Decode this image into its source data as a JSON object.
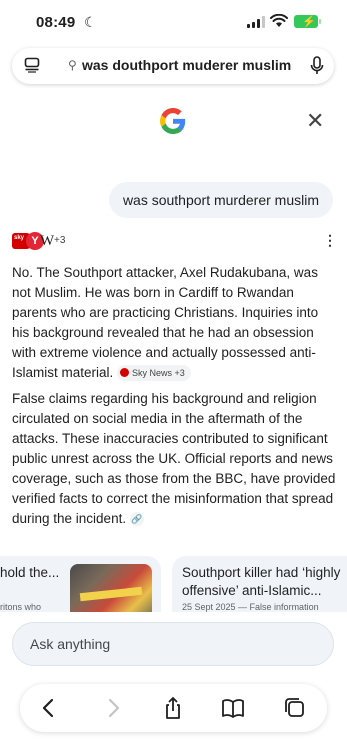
{
  "status": {
    "time": "08:49"
  },
  "address_bar": {
    "query": "was douthport muderer muslim"
  },
  "chat": {
    "user_message": "was southport murderer muslim",
    "sources": {
      "sky_label": "sky",
      "y_label": "Y",
      "w_label": "W",
      "more_count": "+3"
    },
    "paragraph1": "No. The Southport attacker, Axel Rudakubana, was not Muslim. He was born in Cardiff to Rwandan parents who are practicing Christians. Inquiries into his background revealed that he had an obsession with extreme violence and actually possessed anti-Islamist material.",
    "paragraph1_chip": "Sky News +3",
    "paragraph2": "False claims regarding his background and religion circulated on social media in the aftermath of the attacks. These inaccuracies contributed to significant public unrest across the UK. Official reports and news coverage, such as those from the BBC, have provided verified facts to correct the misinformation that spread during the incident."
  },
  "cards": [
    {
      "title": "hold the...",
      "subtitle": "ritons who"
    },
    {
      "title": "Southport killer had ‘highly offensive’ anti-Islamic...",
      "subtitle": "25 Sept 2025 — False information"
    }
  ],
  "ask": {
    "placeholder": "Ask anything"
  },
  "colors": {
    "google_blue": "#4285F4",
    "google_red": "#EA4335",
    "google_yellow": "#FBBC05",
    "google_green": "#34A853",
    "battery_green": "#34c759"
  },
  "icons": [
    "moon-icon",
    "signal-icon",
    "wifi-icon",
    "battery-icon",
    "tabs-sidebar-icon",
    "search-icon",
    "mic-icon",
    "google-logo",
    "close-icon",
    "more-vert-icon",
    "link-icon",
    "back-icon",
    "forward-icon",
    "share-icon",
    "bookmarks-icon",
    "tabs-icon"
  ]
}
